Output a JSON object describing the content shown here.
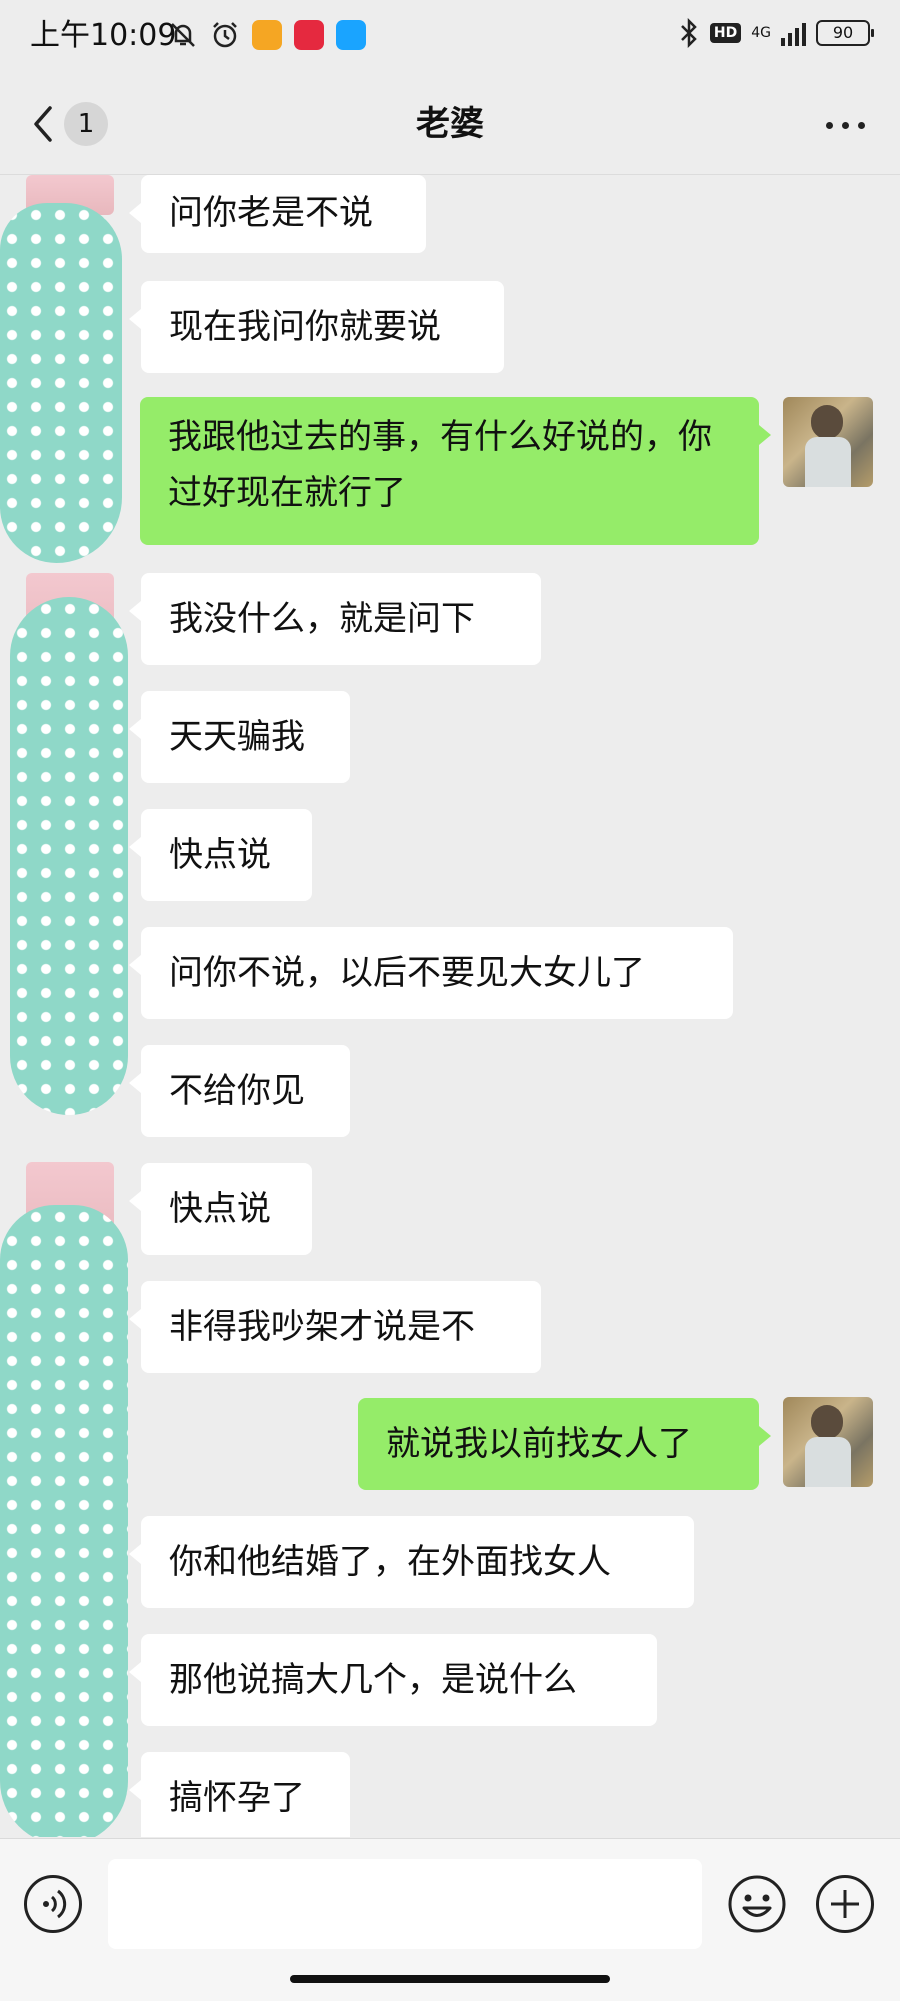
{
  "status_bar": {
    "time": "上午10:09",
    "icons_left": [
      "mute-bell-icon",
      "alarm-icon",
      "app-orange-icon",
      "app-red-icon",
      "app-blue-icon"
    ],
    "icons_right": [
      "bluetooth-icon",
      "hd-icon",
      "network-4g-icon",
      "signal-icon",
      "battery-icon"
    ],
    "hd_label": "HD",
    "network_label": "4G",
    "battery_level": "90"
  },
  "header": {
    "back_badge": "1",
    "title": "老婆"
  },
  "messages": [
    {
      "side": "in",
      "text": "问你老是不说"
    },
    {
      "side": "in",
      "text": "现在我问你就要说"
    },
    {
      "side": "out",
      "text": "我跟他过去的事，有什么好说的，你过好现在就行了"
    },
    {
      "side": "in",
      "text": "我没什么，就是问下"
    },
    {
      "side": "in",
      "text": "天天骗我"
    },
    {
      "side": "in",
      "text": "快点说"
    },
    {
      "side": "in",
      "text": "问你不说，以后不要见大女儿了"
    },
    {
      "side": "in",
      "text": "不给你见"
    },
    {
      "side": "in",
      "text": "快点说"
    },
    {
      "side": "in",
      "text": "非得我吵架才说是不"
    },
    {
      "side": "out",
      "text": "就说我以前找女人了"
    },
    {
      "side": "in",
      "text": "你和他结婚了，在外面找女人"
    },
    {
      "side": "in",
      "text": "那他说搞大几个，是说什么"
    },
    {
      "side": "in",
      "text": "搞怀孕了"
    }
  ],
  "input_bar": {
    "input_value": "",
    "input_placeholder": ""
  },
  "colors": {
    "background": "#ededed",
    "incoming_bubble": "#ffffff",
    "outgoing_bubble": "#95ec69",
    "censor_mask": "#8fd8c8"
  }
}
